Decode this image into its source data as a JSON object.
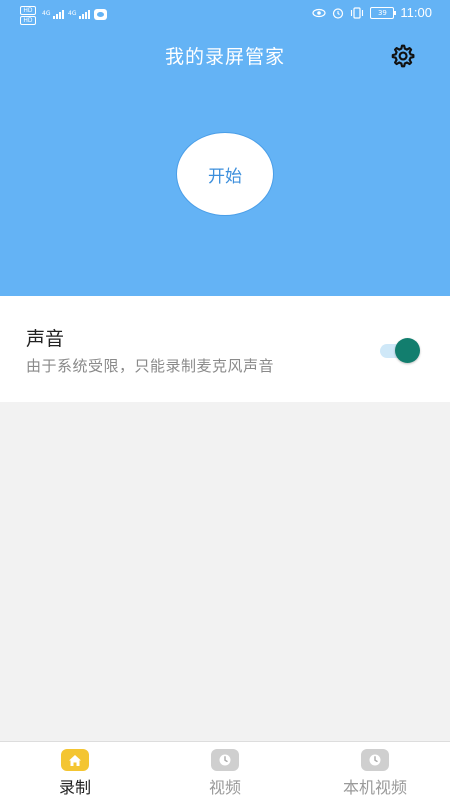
{
  "status_bar": {
    "network_badge_1": "HD",
    "network_badge_2": "HD",
    "signal_1_label": "4G",
    "signal_2_label": "4G",
    "battery": "39",
    "time": "11:00"
  },
  "header": {
    "title": "我的录屏管家",
    "start_label": "开始",
    "bg_color": "#64b3f5"
  },
  "sound": {
    "title": "声音",
    "description": "由于系统受限，只能录制麦克风声音",
    "enabled": true,
    "toggle_color": "#127e6e"
  },
  "bottom_nav": {
    "items": [
      {
        "label": "录制",
        "icon": "home-icon",
        "active": true
      },
      {
        "label": "视频",
        "icon": "clock-icon",
        "active": false
      },
      {
        "label": "本机视频",
        "icon": "clock-icon",
        "active": false
      }
    ],
    "active_color": "#f4c531"
  }
}
